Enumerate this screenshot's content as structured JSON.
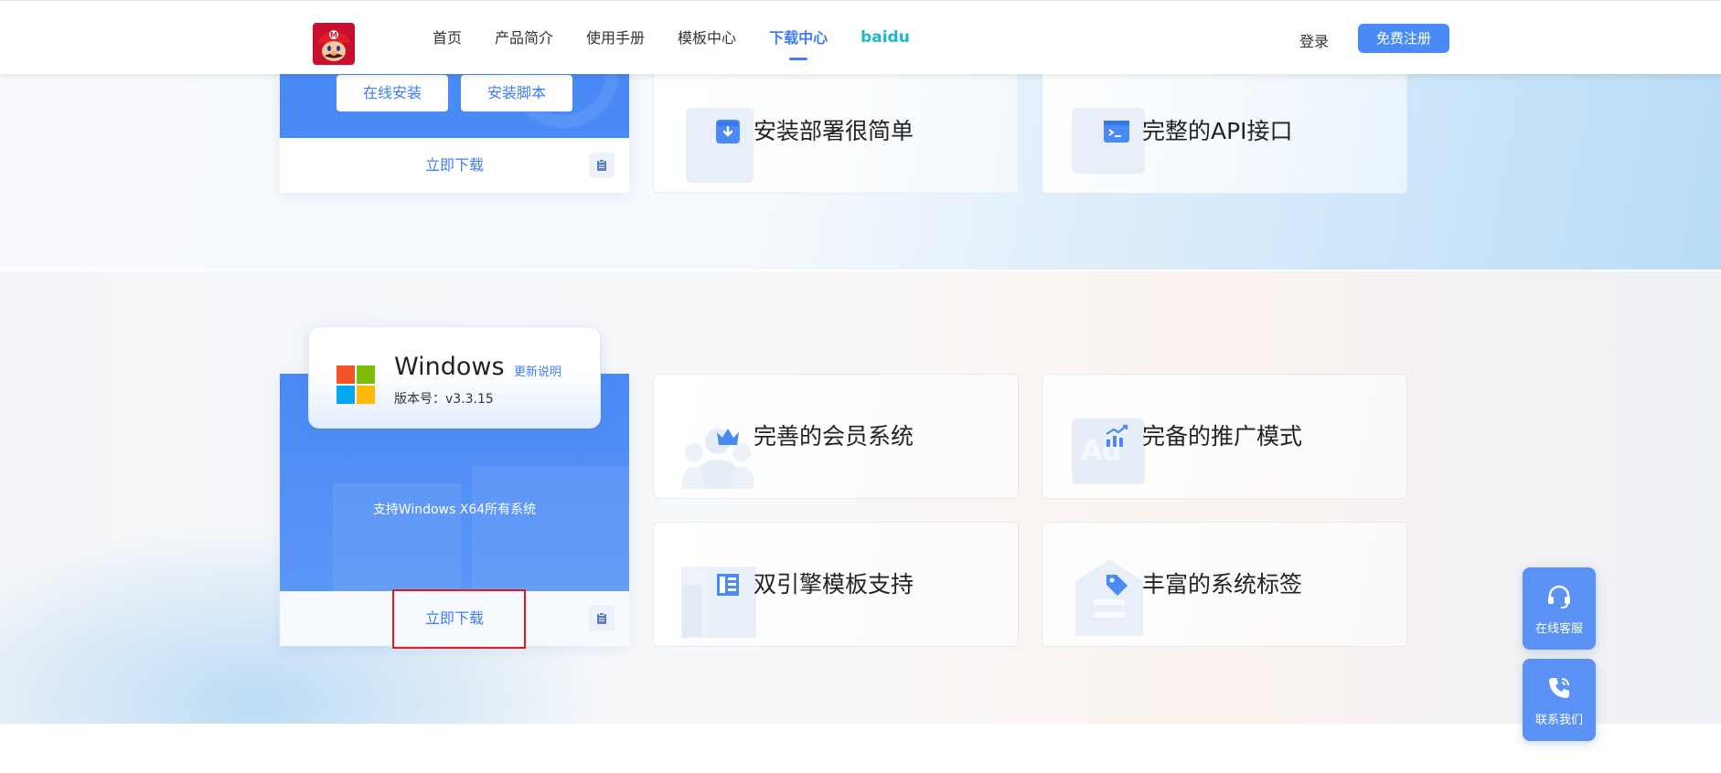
{
  "header": {
    "logo_icon": "mario-avatar-icon",
    "nav": [
      {
        "label": "首页",
        "active": false
      },
      {
        "label": "产品简介",
        "active": false
      },
      {
        "label": "使用手册",
        "active": false
      },
      {
        "label": "模板中心",
        "active": false
      },
      {
        "label": "下载中心",
        "active": true
      },
      {
        "label": "baidu",
        "active": false
      }
    ],
    "login_label": "登录",
    "register_label": "免费注册"
  },
  "linux_card": {
    "online_install_label": "在线安装",
    "install_script_label": "安装脚本",
    "download_label": "立即下载"
  },
  "windows_card": {
    "title": "Windows",
    "update_link": "更新说明",
    "version_label": "版本号：v3.3.15",
    "support_text": "支持Windows X64所有系统",
    "download_label": "立即下载"
  },
  "features": {
    "row1": [
      "安装部署很简单",
      "完整的API接口"
    ],
    "row2": [
      "完善的会员系统",
      "完备的推广模式"
    ],
    "row3": [
      "双引擎模板支持",
      "丰富的系统标签"
    ]
  },
  "floating": {
    "service_label": "在线客服",
    "contact_label": "联系我们"
  },
  "colors": {
    "primary": "#4a8af6",
    "link": "#3f7cf5",
    "brand_cyan": "#1fb6c8",
    "highlight": "#e02020"
  }
}
